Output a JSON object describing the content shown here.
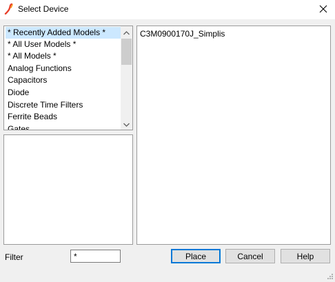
{
  "window": {
    "title": "Select Device",
    "icon": "simplis-logo-icon",
    "close_icon": "close-icon"
  },
  "category_list": {
    "items": [
      {
        "label": "* Recently Added Models *",
        "selected": true
      },
      {
        "label": "* All User Models *",
        "selected": false
      },
      {
        "label": "* All Models *",
        "selected": false
      },
      {
        "label": "Analog Functions",
        "selected": false
      },
      {
        "label": "Capacitors",
        "selected": false
      },
      {
        "label": "Diode",
        "selected": false
      },
      {
        "label": "Discrete Time Filters",
        "selected": false
      },
      {
        "label": "Ferrite Beads",
        "selected": false
      },
      {
        "label": "Gates",
        "selected": false
      }
    ],
    "selection_color": "#cce8ff"
  },
  "device_list": {
    "items": [
      {
        "label": "C3M0900170J_Simplis"
      }
    ]
  },
  "filter": {
    "label": "Filter",
    "value": "*"
  },
  "buttons": {
    "place": "Place",
    "cancel": "Cancel",
    "help": "Help"
  },
  "colors": {
    "accent": "#0078d7",
    "icon_red": "#e8412c",
    "icon_orange": "#f7a21b"
  }
}
